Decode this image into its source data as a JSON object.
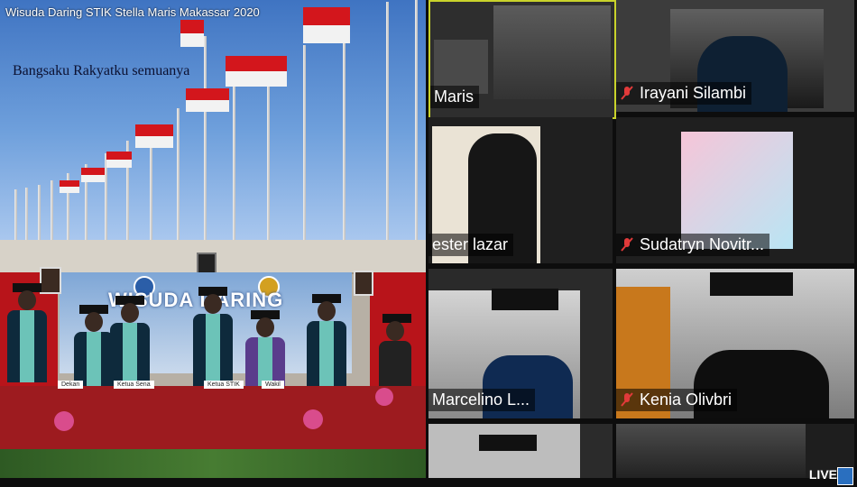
{
  "window": {
    "title": "Wisuda Daring STIK Stella Maris Makassar 2020"
  },
  "slide": {
    "caption": "Bangsaku Rakyatku semuanya"
  },
  "stage": {
    "banner_title": "WISUDA DARING",
    "labels": [
      "Ketua STIK",
      "Dekan",
      "Ketua Sena",
      "Wakil"
    ]
  },
  "participants": [
    {
      "name": "Maris"
    },
    {
      "name": "Irayani Silambi"
    },
    {
      "name": "ester lazar"
    },
    {
      "name": "Sudatryn Novitr..."
    },
    {
      "name": "Marcelino L..."
    },
    {
      "name": "Kenia Olivbri"
    }
  ],
  "player": {
    "live_label": "LIVE"
  },
  "colors": {
    "mute": "#e23a3a",
    "flag_red": "#d3161c",
    "sash": "#6cc3b8"
  }
}
